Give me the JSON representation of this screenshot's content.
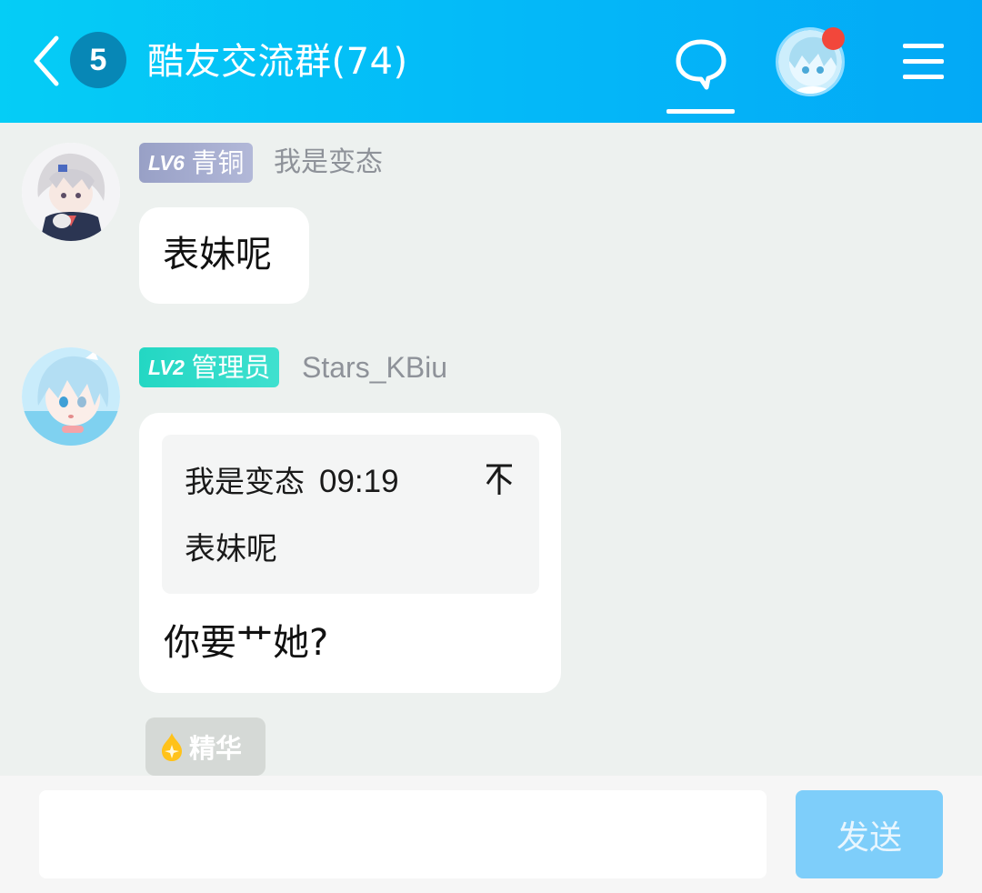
{
  "header": {
    "unread_count": "5",
    "title": "酷友交流群(74)",
    "chat_tab_icon": "speech-bubble-icon",
    "menu_icon": "hamburger-menu-icon",
    "notification_color": "#f2473b",
    "bar_color": "#05c3f7"
  },
  "messages": [
    {
      "level": "LV6",
      "level_title": "青铜",
      "username": "我是变态",
      "text": "表妹呢"
    },
    {
      "level": "LV2",
      "level_title": "管理员",
      "username": "Stars_KBiu",
      "quote": {
        "author": "我是变态",
        "time": "09:19",
        "text": "表妹呢",
        "jump_icon": "scroll-to-top-icon"
      },
      "text": "你要艹她?",
      "tag": "精华"
    }
  ],
  "input": {
    "placeholder": "",
    "value": "",
    "send_label": "发送"
  }
}
